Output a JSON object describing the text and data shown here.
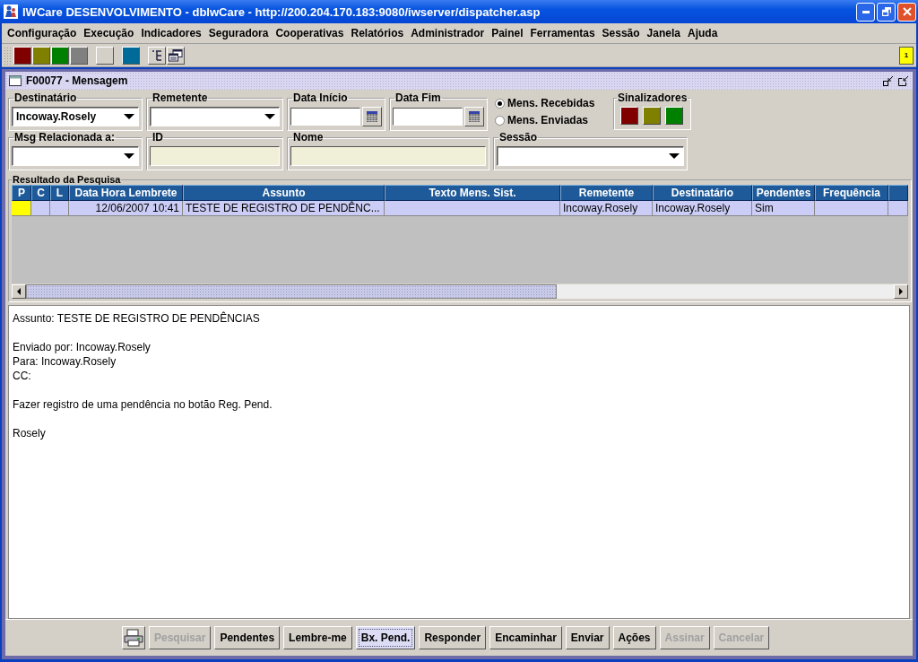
{
  "window": {
    "title": "IWCare DESENVOLVIMENTO - dbIwCare - http://200.204.170.183:9080/iwserver/dispatcher.asp"
  },
  "menu": [
    "Configuração",
    "Execução",
    "Indicadores",
    "Seguradora",
    "Cooperativas",
    "Relatórios",
    "Administrador",
    "Painel",
    "Ferramentas",
    "Sessão",
    "Janela",
    "Ajuda"
  ],
  "toolbar": {
    "items": [
      {
        "kind": "color",
        "color": "#800000"
      },
      {
        "kind": "color",
        "color": "#808000"
      },
      {
        "kind": "color",
        "color": "#008000"
      },
      {
        "kind": "color",
        "color": "#808080"
      },
      {
        "kind": "gap"
      },
      {
        "kind": "color",
        "color": "#d4d0c8"
      },
      {
        "kind": "gap"
      },
      {
        "kind": "color",
        "color": "#006b99"
      },
      {
        "kind": "gap"
      },
      {
        "kind": "tree"
      },
      {
        "kind": "windows"
      }
    ],
    "badge": "1"
  },
  "frame": {
    "title": "F00077 - Mensagem"
  },
  "filters": {
    "destinatario": {
      "label": "Destinatário",
      "value": "Incoway.Rosely"
    },
    "remetente": {
      "label": "Remetente"
    },
    "data_inicio": {
      "label": "Data Início"
    },
    "data_fim": {
      "label": "Data Fim"
    },
    "mode": [
      {
        "label": "Mens. Recebidas",
        "selected": true
      },
      {
        "label": "Mens. Enviadas",
        "selected": false
      }
    ],
    "sinalizadores": {
      "label": "Sinalizadores",
      "buttons": [
        {
          "color": "#800000"
        },
        {
          "color": "#808000"
        },
        {
          "color": "#008000"
        }
      ]
    },
    "msg_relacionada": {
      "label": "Msg Relacionada a:"
    },
    "id": {
      "label": "ID"
    },
    "nome": {
      "label": "Nome"
    },
    "sessao": {
      "label": "Sessão"
    }
  },
  "results": {
    "title": "Resultado da Pesquisa",
    "columns": [
      "P",
      "C",
      "L",
      "Data Hora Lembrete",
      "Assunto",
      "Texto Mens. Sist.",
      "Remetente",
      "Destinatário",
      "Pendentes",
      "Frequência"
    ],
    "rows": [
      {
        "selected": true,
        "color": "#ffff00",
        "data": "12/06/2007 10:41",
        "assunto": "TESTE DE REGISTRO DE PENDÊNC...",
        "remetente": "Incoway.Rosely",
        "destinatario": "Incoway.Rosely",
        "pendentes": "Sim"
      }
    ]
  },
  "message": {
    "paragraphs": [
      [
        "Assunto: TESTE DE REGISTRO DE PENDÊNCIAS"
      ],
      [
        "Enviado por: Incoway.Rosely",
        "Para: Incoway.Rosely",
        "CC:"
      ],
      [
        "Fazer registro de uma pendência no botão Reg. Pend."
      ],
      [
        "Rosely"
      ]
    ]
  },
  "buttons": [
    {
      "label": "Pesquisar",
      "disabled": true,
      "focused": false
    },
    {
      "label": "Pendentes",
      "disabled": false,
      "focused": false
    },
    {
      "label": "Lembre-me",
      "disabled": false,
      "focused": false
    },
    {
      "label": "Bx. Pend.",
      "disabled": false,
      "focused": true
    },
    {
      "label": "Responder",
      "disabled": false,
      "focused": false
    },
    {
      "label": "Encaminhar",
      "disabled": false,
      "focused": false
    },
    {
      "label": "Enviar",
      "disabled": false,
      "focused": false
    },
    {
      "label": "Ações",
      "disabled": false,
      "focused": false
    },
    {
      "label": "Assinar",
      "disabled": true,
      "focused": false
    },
    {
      "label": "Cancelar",
      "disabled": true,
      "focused": false
    }
  ]
}
